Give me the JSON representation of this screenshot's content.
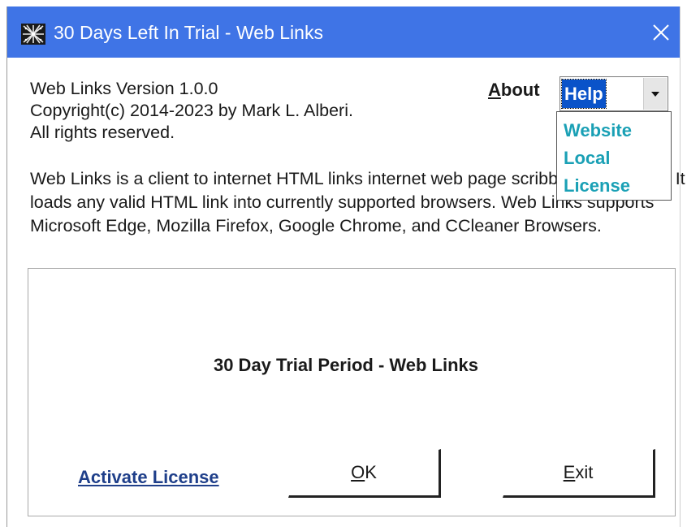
{
  "window": {
    "title": "30 Days Left In Trial - Web Links"
  },
  "info": {
    "version": "Web Links Version 1.0.0",
    "copyright": "Copyright(c) 2014-2023 by Mark L. Alberi.",
    "rights": "All rights reserved."
  },
  "description": "Web Links is a client to internet HTML links internet web page scribbler application. It loads any valid HTML link into currently supported browsers. Web Links supports Microsoft Edge, Mozilla Firefox, Google Chrome, and CCleaner Browsers.",
  "about": {
    "label_mnemonic": "A",
    "label_rest": "bout"
  },
  "help_menu": {
    "selected": "Help",
    "options": [
      "Website",
      "Local",
      "License"
    ]
  },
  "panel": {
    "title": "30 Day Trial Period - Web Links",
    "activate_link": "Activate License",
    "ok_mnemonic": "O",
    "ok_rest": "K",
    "exit_mnemonic": "E",
    "exit_rest": "xit"
  },
  "colors": {
    "titlebar": "#3f74e6",
    "selection": "#0a53c9",
    "dropdown_text": "#1aa0b5",
    "link": "#1f3f8a"
  }
}
